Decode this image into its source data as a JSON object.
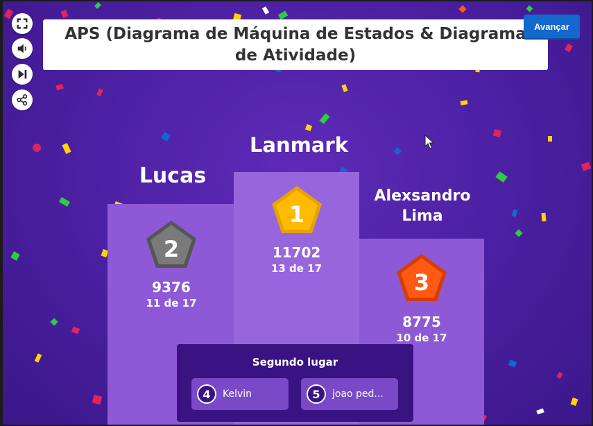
{
  "colors": {
    "background": "#4a1fa0",
    "podium": "#8d59d6",
    "first_badge": "#ffbb00",
    "second_badge": "#7a7a7a",
    "third_badge": "#ff5a14",
    "next_button": "#1368ce",
    "runners_panel": "#3a1382"
  },
  "controls": {
    "fullscreen_icon": "fullscreen-icon",
    "volume_icon": "volume-icon",
    "skip_icon": "skip-icon",
    "share_icon": "share-icon"
  },
  "header": {
    "title": "APS (Diagrama de Máquina de Estados & Diagrama de Atividade)",
    "next_label": "Avançar"
  },
  "podium": {
    "first": {
      "name": "Lanmark",
      "rank": "1",
      "score": "11702",
      "correct": "13 de 17"
    },
    "second": {
      "name": "Lucas",
      "rank": "2",
      "score": "9376",
      "correct": "11 de 17"
    },
    "third": {
      "name": "Alexsandro Lima",
      "rank": "3",
      "score": "8775",
      "correct": "10 de 17"
    }
  },
  "runners_up": {
    "title": "Segundo lugar",
    "items": [
      {
        "rank": "4",
        "name": "Kelvin"
      },
      {
        "rank": "5",
        "name": "joao ped..."
      }
    ]
  }
}
